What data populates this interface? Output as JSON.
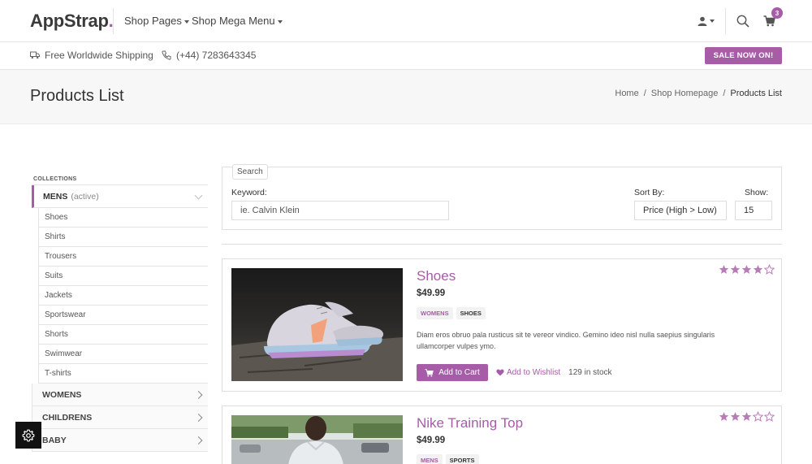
{
  "header": {
    "logo_text": "AppStrap",
    "logo_dot": ".",
    "nav": [
      {
        "label": "Shop Pages"
      },
      {
        "label": "Shop Mega Menu"
      }
    ],
    "cart_count": "3"
  },
  "infobar": {
    "shipping": "Free Worldwide Shipping",
    "phone": "(+44) 7283643345",
    "sale_label": "SALE NOW ON!"
  },
  "page": {
    "title": "Products List",
    "breadcrumb": [
      "Home",
      "Shop Homepage",
      "Products List"
    ]
  },
  "sidebar": {
    "caption": "COLLECTIONS",
    "active_category": "MENS",
    "active_note": "(active)",
    "subitems": [
      "Shoes",
      "Shirts",
      "Trousers",
      "Suits",
      "Jackets",
      "Sportswear",
      "Shorts",
      "Swimwear",
      "T-shirts"
    ],
    "categories": [
      "WOMENS",
      "CHILDRENS",
      "BABY"
    ]
  },
  "search": {
    "legend": "Search",
    "keyword_label": "Keyword:",
    "keyword_placeholder": "ie. Calvin Klein",
    "sort_label": "Sort By:",
    "sort_value": "Price (High > Low)",
    "show_label": "Show:",
    "show_value": "15"
  },
  "products": [
    {
      "name": "Shoes",
      "price": "$49.99",
      "tags": [
        "WOMENS",
        "SHOES"
      ],
      "description": "Diam eros obruo pala rusticus sit te vereor vindico. Gemino ideo nisl nulla saepius singularis ullamcorper vulpes ymo.",
      "add_to_cart": "Add to Cart",
      "wishlist": "Add to Wishlist",
      "stock": "129 in stock",
      "rating": 4
    },
    {
      "name": "Nike Training Top",
      "price": "$49.99",
      "tags": [
        "MENS",
        "SPORTS"
      ],
      "rating": 3
    }
  ],
  "colors": {
    "accent": "#a65ca6"
  }
}
